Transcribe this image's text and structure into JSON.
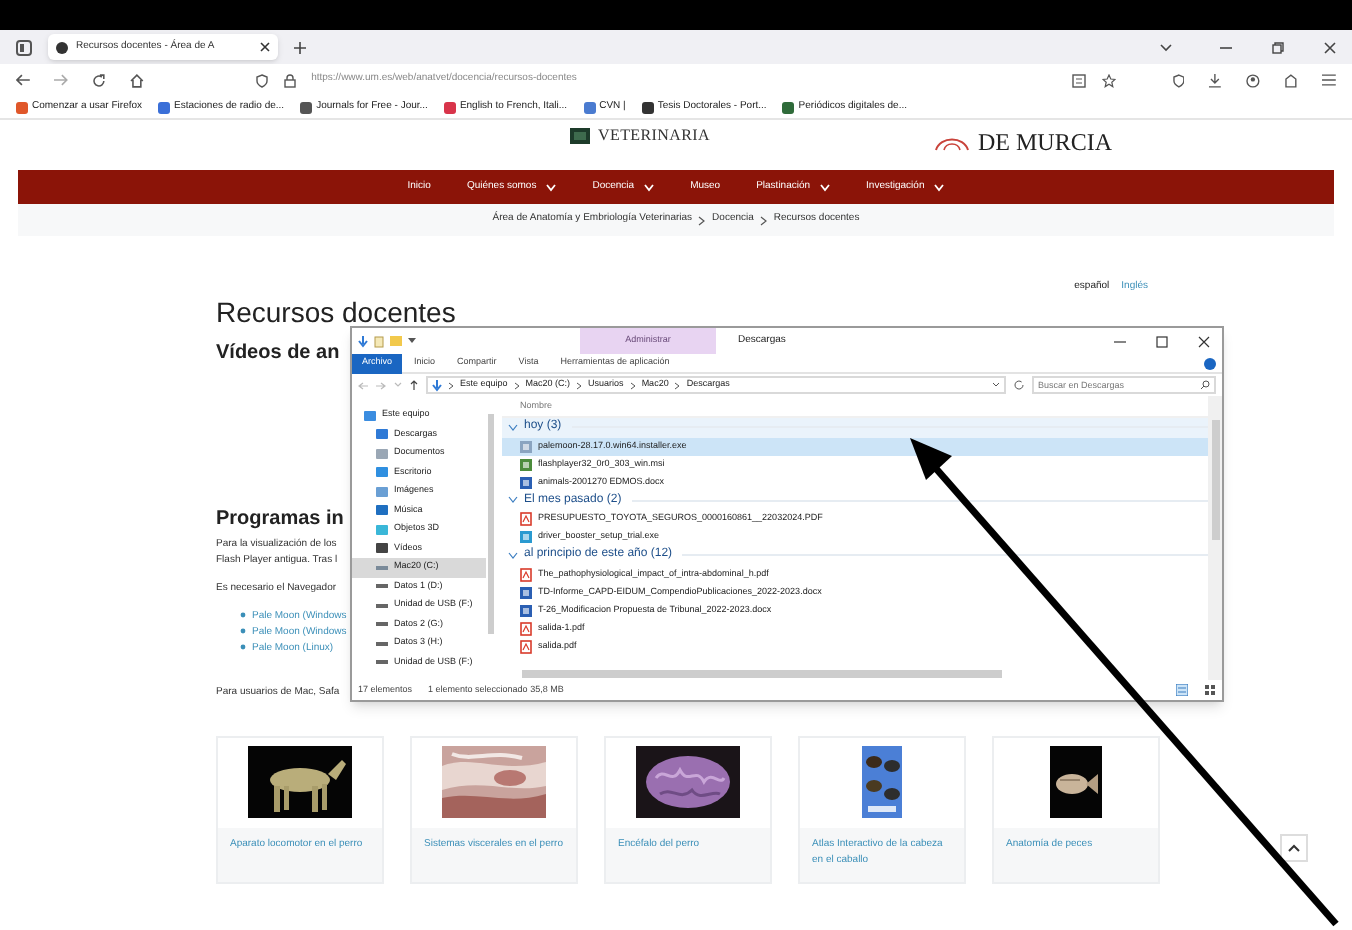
{
  "browser": {
    "tab_title": "Recursos docentes - Área de A",
    "url": "https://www.um.es/web/anatvet/docencia/recursos-docentes",
    "bookmarks": [
      {
        "label": "Comenzar a usar Firefox",
        "color": "#e0572a"
      },
      {
        "label": "Estaciones de radio de...",
        "color": "#3a6fd8"
      },
      {
        "label": "Journals for Free - Jour...",
        "color": "#555555"
      },
      {
        "label": "English to French, Itali...",
        "color": "#d8344a"
      },
      {
        "label": "CVN |",
        "color": "#4a7bd0"
      },
      {
        "label": "Tesis Doctorales - Port...",
        "color": "#333333"
      },
      {
        "label": "Periódicos digitales de...",
        "color": "#2f6b3a"
      }
    ]
  },
  "site": {
    "header_left": "VETERINARIA",
    "header_right": "DE MURCIA",
    "nav": [
      {
        "label": "Inicio",
        "dropdown": false
      },
      {
        "label": "Quiénes somos",
        "dropdown": true
      },
      {
        "label": "Docencia",
        "dropdown": true
      },
      {
        "label": "Museo",
        "dropdown": false
      },
      {
        "label": "Plastinación",
        "dropdown": true
      },
      {
        "label": "Investigación",
        "dropdown": true
      }
    ],
    "breadcrumb": [
      "Área de Anatomía y Embriología Veterinarias",
      "Docencia",
      "Recursos docentes"
    ],
    "languages": [
      {
        "label": "español",
        "selected": true
      },
      {
        "label": "Inglés",
        "selected": false
      }
    ],
    "title": "Recursos docentes",
    "subtitle": "Vídeos de an",
    "section": "Programas in",
    "paragraphs": [
      "Para la visualización de los",
      "Flash Player antigua. Tras l",
      "Es necesario el Navegador"
    ],
    "links": [
      "Pale Moon (Windows",
      "Pale Moon (Windows",
      "Pale Moon (Linux)"
    ],
    "note": "Para usuarios de Mac, Safa",
    "cards": [
      {
        "label": "Aparato locomotor en el perro"
      },
      {
        "label": "Sistemas viscerales en el perro"
      },
      {
        "label": "Encéfalo del perro"
      },
      {
        "label": "Atlas Interactivo de la cabeza en el caballo"
      },
      {
        "label": "Anatomía de peces"
      }
    ]
  },
  "explorer": {
    "context_tab": "Administrar",
    "title": "Descargas",
    "ribbon": [
      {
        "label": "Archivo",
        "selected": true
      },
      {
        "label": "Inicio",
        "selected": false
      },
      {
        "label": "Compartir",
        "selected": false
      },
      {
        "label": "Vista",
        "selected": false
      },
      {
        "label": "Herramientas de aplicación",
        "selected": false
      }
    ],
    "path": [
      "Este equipo",
      "Mac20 (C:)",
      "Usuarios",
      "Mac20",
      "Descargas"
    ],
    "search_placeholder": "Buscar en Descargas",
    "nav_items": [
      {
        "label": "Este equipo",
        "kind": "pc",
        "selected": false
      },
      {
        "label": "Descargas",
        "kind": "download",
        "selected": false
      },
      {
        "label": "Documentos",
        "kind": "docs",
        "selected": false
      },
      {
        "label": "Escritorio",
        "kind": "desktop",
        "selected": false
      },
      {
        "label": "Imágenes",
        "kind": "images",
        "selected": false
      },
      {
        "label": "Música",
        "kind": "music",
        "selected": false
      },
      {
        "label": "Objetos 3D",
        "kind": "cube",
        "selected": false
      },
      {
        "label": "Vídeos",
        "kind": "videos",
        "selected": false
      },
      {
        "label": "Mac20 (C:)",
        "kind": "system",
        "selected": true
      },
      {
        "label": "Datos 1 (D:)",
        "kind": "drive",
        "selected": false
      },
      {
        "label": "Unidad de USB (F:)",
        "kind": "drive",
        "selected": false
      },
      {
        "label": "Datos 2 (G:)",
        "kind": "drive",
        "selected": false
      },
      {
        "label": "Datos 3 (H:)",
        "kind": "drive",
        "selected": false
      },
      {
        "label": "Unidad de USB (F:)",
        "kind": "drive",
        "selected": false
      }
    ],
    "column": "Nombre",
    "groups": [
      {
        "label": "hoy (3)",
        "expanded": true,
        "files": [
          {
            "name": "palemoon-28.17.0.win64.installer.exe",
            "kind": "installer",
            "selected": true
          },
          {
            "name": "flashplayer32_0r0_303_win.msi",
            "kind": "package",
            "selected": false
          },
          {
            "name": "animals-2001270 EDMOS.docx",
            "kind": "word",
            "selected": false
          }
        ]
      },
      {
        "label": "El mes pasado (2)",
        "expanded": true,
        "files": [
          {
            "name": "PRESUPUESTO_TOYOTA_SEGUROS_0000160861__22032024.PDF",
            "kind": "pdf",
            "selected": false
          },
          {
            "name": "driver_booster_setup_trial.exe",
            "kind": "app",
            "selected": false
          }
        ]
      },
      {
        "label": "al principio de este año (12)",
        "expanded": true,
        "files": [
          {
            "name": "The_pathophysiological_impact_of_intra-abdominal_h.pdf",
            "kind": "pdf",
            "selected": false
          },
          {
            "name": "TD-Informe_CAPD-EIDUM_CompendioPublicaciones_2022-2023.docx",
            "kind": "word",
            "selected": false
          },
          {
            "name": "T-26_Modificacion Propuesta de Tribunal_2022-2023.docx",
            "kind": "word",
            "selected": false
          },
          {
            "name": "salida-1.pdf",
            "kind": "pdf",
            "selected": false
          },
          {
            "name": "salida.pdf",
            "kind": "pdf",
            "selected": false
          }
        ]
      }
    ],
    "status": [
      "17 elementos",
      "1 elemento seleccionado 35,8 MB"
    ]
  }
}
